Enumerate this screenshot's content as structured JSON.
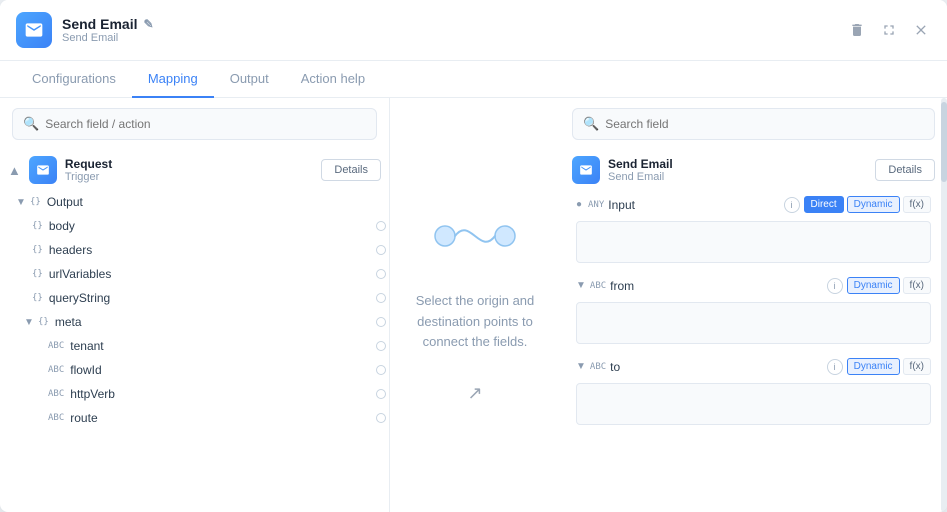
{
  "window": {
    "title": "Send Email",
    "subtitle": "Send Email",
    "icon": "email-icon"
  },
  "controls": {
    "delete_icon": "🗑",
    "expand_icon": "⤢",
    "close_icon": "✕"
  },
  "tabs": [
    {
      "id": "configurations",
      "label": "Configurations",
      "active": false
    },
    {
      "id": "mapping",
      "label": "Mapping",
      "active": true
    },
    {
      "id": "output",
      "label": "Output",
      "active": false
    },
    {
      "id": "action-help",
      "label": "Action help",
      "active": false
    }
  ],
  "left_panel": {
    "search_placeholder": "Search field / action",
    "trigger": {
      "label": "Request",
      "sub_label": "Trigger",
      "details_btn": "Details"
    },
    "tree": [
      {
        "id": "output",
        "level": 0,
        "type": "{}",
        "label": "Output",
        "chevron": "▼",
        "collapsed": false
      },
      {
        "id": "body",
        "level": 1,
        "type": "{}",
        "label": "body",
        "has_dot": true
      },
      {
        "id": "headers",
        "level": 1,
        "type": "{}",
        "label": "headers",
        "has_dot": true
      },
      {
        "id": "urlVariables",
        "level": 1,
        "type": "{}",
        "label": "urlVariables",
        "has_dot": true
      },
      {
        "id": "queryString",
        "level": 1,
        "type": "{}",
        "label": "queryString",
        "has_dot": true
      },
      {
        "id": "meta",
        "level": 1,
        "type": "{}",
        "label": "meta",
        "chevron": "▼",
        "has_dot": true
      },
      {
        "id": "tenant",
        "level": 2,
        "type": "ABC",
        "label": "tenant",
        "has_dot": true
      },
      {
        "id": "flowId",
        "level": 2,
        "type": "ABC",
        "label": "flowId",
        "has_dot": true
      },
      {
        "id": "httpVerb",
        "level": 2,
        "type": "ABC",
        "label": "httpVerb",
        "has_dot": true
      },
      {
        "id": "route",
        "level": 2,
        "type": "ABC",
        "label": "route",
        "has_dot": true
      }
    ]
  },
  "center_panel": {
    "instruction": "Select the origin and destination points to connect the fields."
  },
  "right_panel": {
    "search_placeholder": "Search field",
    "destination": {
      "label": "Send Email",
      "sub_label": "Send Email",
      "details_btn": "Details"
    },
    "fields": [
      {
        "id": "input",
        "label": "Input",
        "type": "any",
        "type_display": "ANY",
        "collapsed": false,
        "tags": [
          "Direct",
          "Dynamic",
          "f(x)"
        ],
        "active_tags": [
          "Direct",
          "Dynamic"
        ]
      },
      {
        "id": "from",
        "label": "from",
        "type": "string",
        "type_display": "ABC",
        "collapsed": false,
        "tags": [
          "Dynamic",
          "f(x)"
        ],
        "active_tags": [
          "Dynamic"
        ]
      },
      {
        "id": "to",
        "label": "to",
        "type": "string",
        "type_display": "ABC",
        "collapsed": false,
        "tags": [
          "Dynamic",
          "f(x)"
        ],
        "active_tags": [
          "Dynamic"
        ]
      }
    ]
  }
}
